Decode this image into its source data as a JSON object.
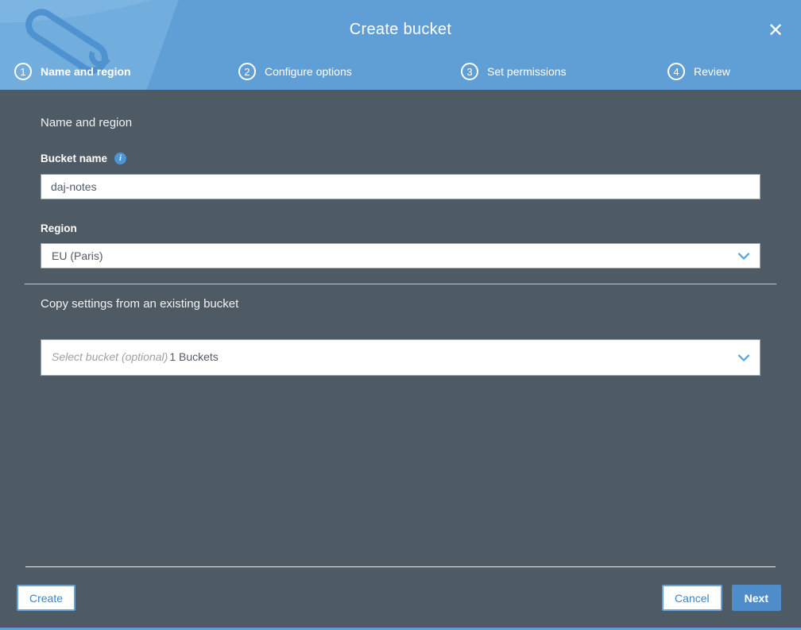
{
  "header": {
    "title": "Create bucket",
    "close_icon": "✕",
    "steps": [
      {
        "number": "1",
        "label": "Name and region",
        "active": true
      },
      {
        "number": "2",
        "label": "Configure options",
        "active": false
      },
      {
        "number": "3",
        "label": "Set permissions",
        "active": false
      },
      {
        "number": "4",
        "label": "Review",
        "active": false
      }
    ]
  },
  "form": {
    "section_title": "Name and region",
    "bucket_name_label": "Bucket name",
    "bucket_name_value": "daj-notes",
    "region_label": "Region",
    "region_value": "EU (Paris)",
    "copy_section_title": "Copy settings from an existing bucket",
    "copy_placeholder": "Select bucket (optional)",
    "copy_count": "1 Buckets"
  },
  "footer": {
    "create_label": "Create",
    "cancel_label": "Cancel",
    "next_label": "Next"
  },
  "colors": {
    "header_blue": "#5f9fd6",
    "body_slate": "#4e5a64",
    "accent_blue": "#4e8dca",
    "link_blue": "#3e84c8",
    "chevron_blue": "#539fe0"
  }
}
